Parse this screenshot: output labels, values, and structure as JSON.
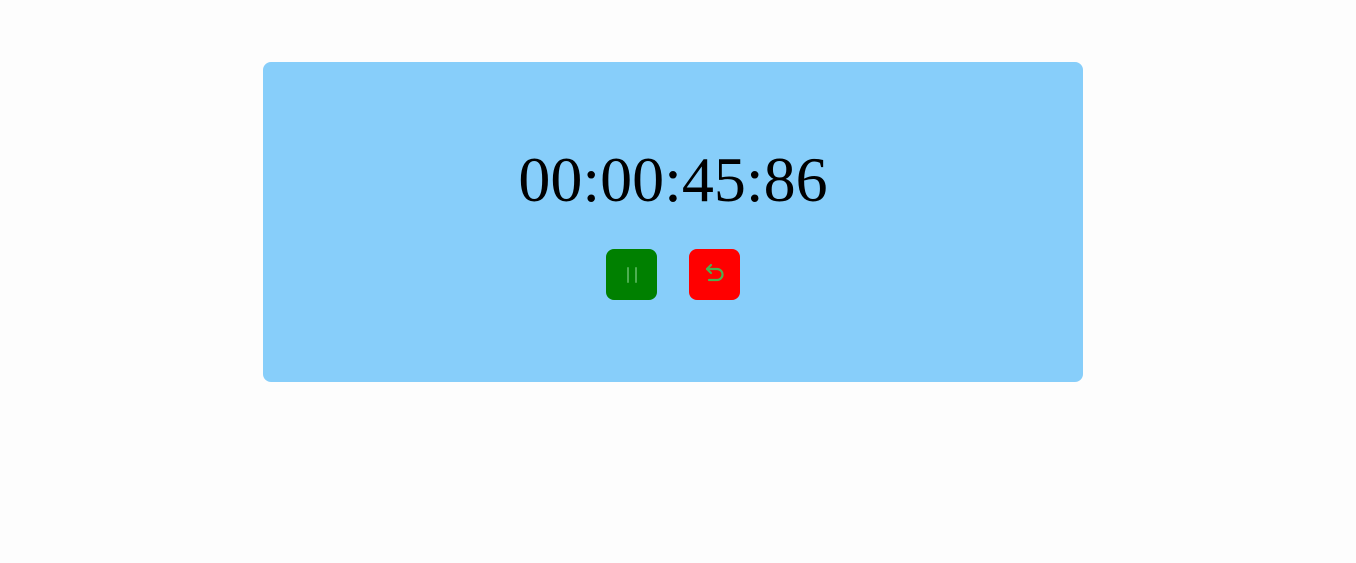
{
  "stopwatch": {
    "time": "00:00:45:86",
    "colors": {
      "card_background": "#87cefa",
      "pause_button": "#008000",
      "reset_button": "#ff0000",
      "icon_stroke": "#4caf50"
    },
    "buttons": [
      {
        "name": "pause-button",
        "icon": "pause-icon"
      },
      {
        "name": "reset-button",
        "icon": "undo-icon"
      }
    ]
  }
}
